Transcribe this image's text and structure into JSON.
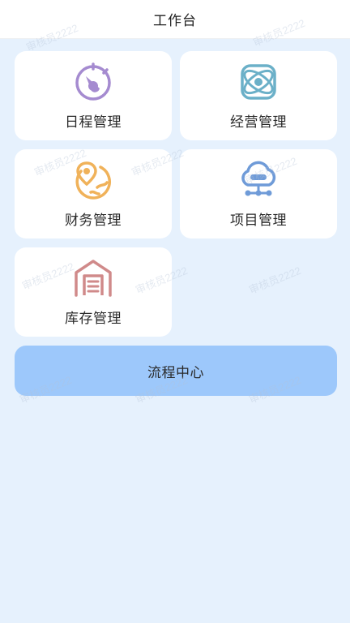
{
  "header": {
    "title": "工作台"
  },
  "grid": {
    "items": [
      {
        "label": "日程管理",
        "icon": "dashboard-gauge-icon",
        "color": "#a58bd0"
      },
      {
        "label": "经营管理",
        "icon": "atom-orbit-icon",
        "color": "#6bb0c8"
      },
      {
        "label": "财务管理",
        "icon": "globe-location-pin-icon",
        "color": "#f0b25a"
      },
      {
        "label": "项目管理",
        "icon": "cloud-network-icon",
        "color": "#6f9bd8"
      },
      {
        "label": "库存管理",
        "icon": "warehouse-icon",
        "color": "#d08a8a"
      }
    ]
  },
  "process": {
    "label": "流程中心",
    "color": "#9dc8fb"
  },
  "watermark": {
    "text": "审核员2222"
  },
  "colors": {
    "background": "#e6f1fd",
    "card": "#ffffff"
  }
}
